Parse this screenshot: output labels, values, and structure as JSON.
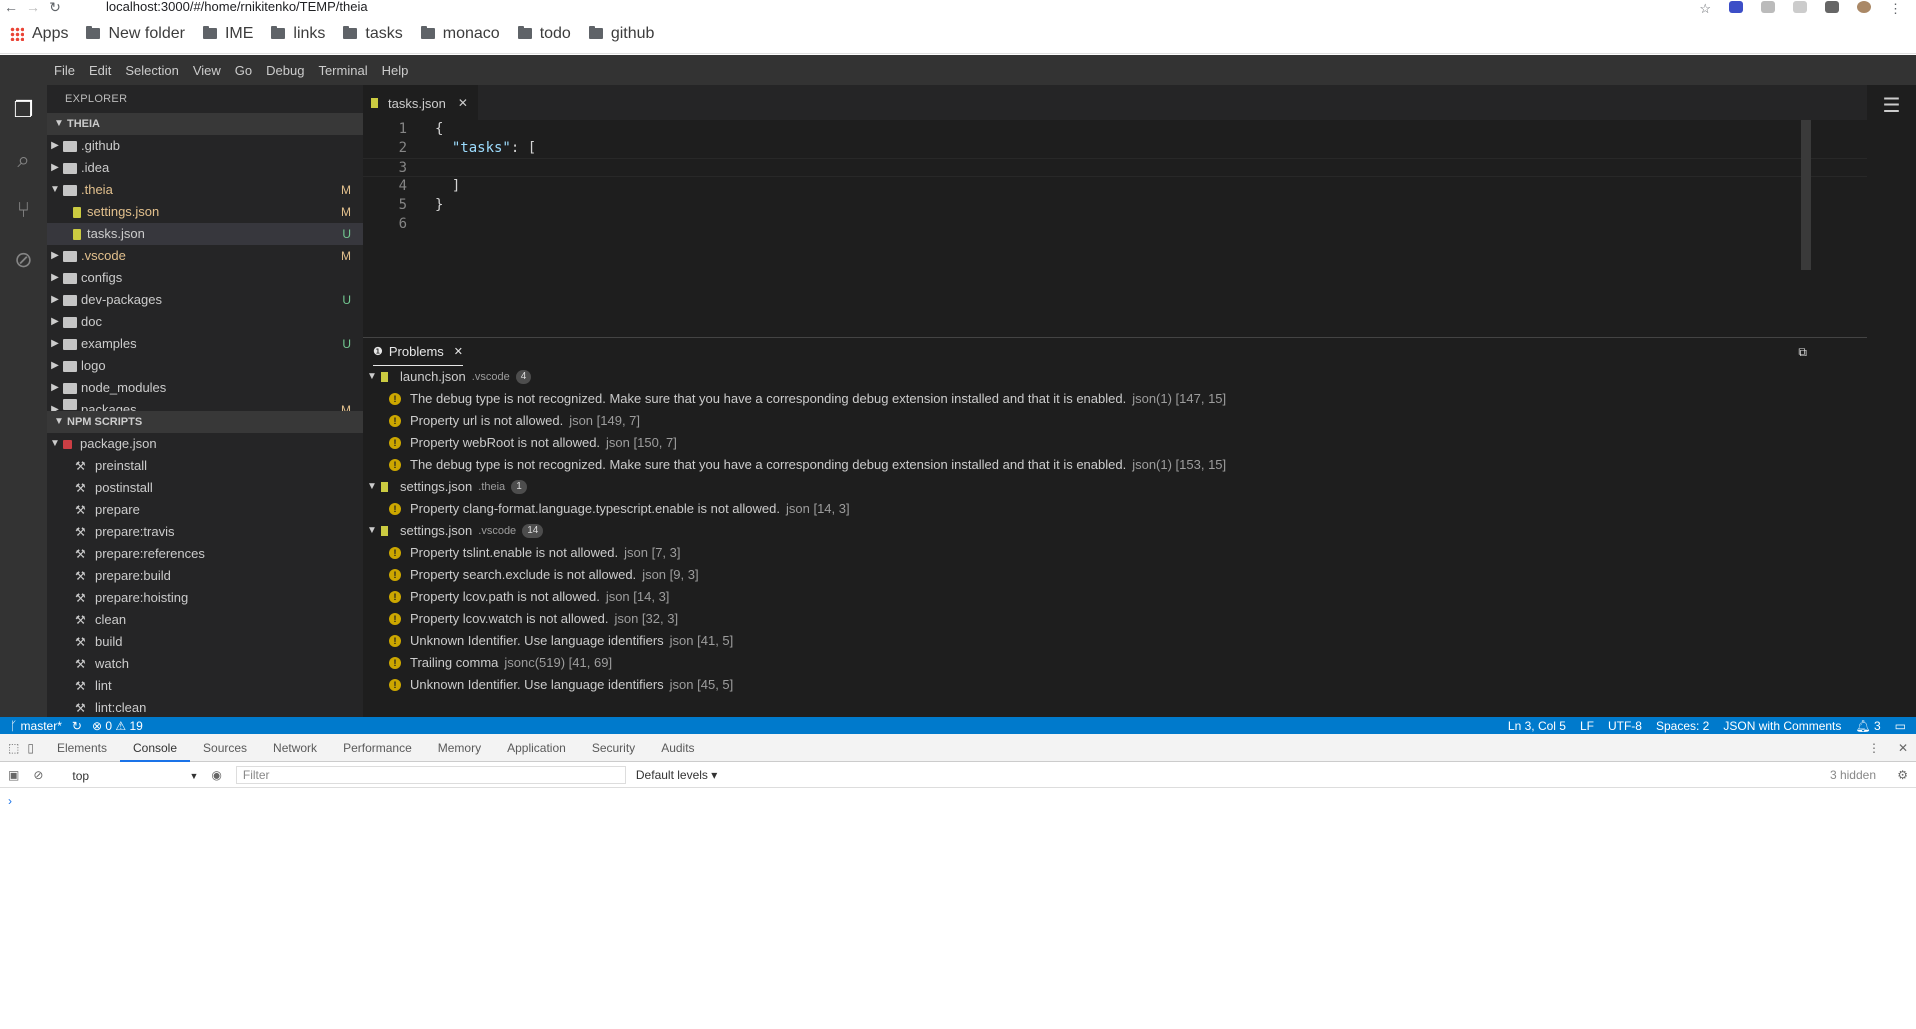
{
  "browser": {
    "url": "localhost:3000/#/home/rnikitenko/TEMP/theia",
    "bookmarks": [
      "Apps",
      "New folder",
      "IME",
      "links",
      "tasks",
      "monaco",
      "todo",
      "github"
    ]
  },
  "menu": [
    "File",
    "Edit",
    "Selection",
    "View",
    "Go",
    "Debug",
    "Terminal",
    "Help"
  ],
  "explorer": {
    "title": "EXPLORER",
    "root": "THEIA",
    "items": [
      {
        "label": ".github",
        "type": "folder",
        "badge": ""
      },
      {
        "label": ".idea",
        "type": "folder",
        "badge": ""
      },
      {
        "label": ".theia",
        "type": "folder-open",
        "badge": "M"
      },
      {
        "label": "settings.json",
        "type": "json",
        "badge": "M"
      },
      {
        "label": "tasks.json",
        "type": "json",
        "badge": "U"
      },
      {
        "label": ".vscode",
        "type": "folder",
        "badge": "M"
      },
      {
        "label": "configs",
        "type": "folder",
        "badge": ""
      },
      {
        "label": "dev-packages",
        "type": "folder",
        "badge": "U"
      },
      {
        "label": "doc",
        "type": "folder",
        "badge": ""
      },
      {
        "label": "examples",
        "type": "folder",
        "badge": "U"
      },
      {
        "label": "logo",
        "type": "folder",
        "badge": ""
      },
      {
        "label": "node_modules",
        "type": "folder",
        "badge": ""
      },
      {
        "label": "packages",
        "type": "folder",
        "badge": "M"
      }
    ]
  },
  "npm": {
    "title": "NPM SCRIPTS",
    "package": "package.json",
    "scripts": [
      "preinstall",
      "postinstall",
      "prepare",
      "prepare:travis",
      "prepare:references",
      "prepare:build",
      "prepare:hoisting",
      "clean",
      "build",
      "watch",
      "lint",
      "lint:clean"
    ]
  },
  "editor": {
    "tab": "tasks.json",
    "lines": [
      "1",
      "2",
      "3",
      "4",
      "5",
      "6"
    ],
    "code": {
      "l1": "{",
      "l2_key": "\"tasks\"",
      "l2_rest": ": [",
      "l3": "",
      "l4": "  ]",
      "l5": "}",
      "l6": ""
    }
  },
  "problems": {
    "title": "Problems",
    "groups": [
      {
        "file": "launch.json",
        "dir": ".vscode",
        "count": "4",
        "items": [
          {
            "msg": "The debug type is not recognized. Make sure that you have a corresponding debug extension installed and that it is enabled.",
            "src": "json(1) [147, 15]"
          },
          {
            "msg": "Property url is not allowed.",
            "src": "json [149, 7]"
          },
          {
            "msg": "Property webRoot is not allowed.",
            "src": "json [150, 7]"
          },
          {
            "msg": "The debug type is not recognized. Make sure that you have a corresponding debug extension installed and that it is enabled.",
            "src": "json(1) [153, 15]"
          }
        ]
      },
      {
        "file": "settings.json",
        "dir": ".theia",
        "count": "1",
        "items": [
          {
            "msg": "Property clang-format.language.typescript.enable is not allowed.",
            "src": "json [14, 3]"
          }
        ]
      },
      {
        "file": "settings.json",
        "dir": ".vscode",
        "count": "14",
        "items": [
          {
            "msg": "Property tslint.enable is not allowed.",
            "src": "json [7, 3]"
          },
          {
            "msg": "Property search.exclude is not allowed.",
            "src": "json [9, 3]"
          },
          {
            "msg": "Property lcov.path is not allowed.",
            "src": "json [14, 3]"
          },
          {
            "msg": "Property lcov.watch is not allowed.",
            "src": "json [32, 3]"
          },
          {
            "msg": "Unknown Identifier. Use language identifiers",
            "src": "json [41, 5]"
          },
          {
            "msg": "Trailing comma",
            "src": "jsonc(519) [41, 69]"
          },
          {
            "msg": "Unknown Identifier. Use language identifiers",
            "src": "json [45, 5]"
          }
        ]
      }
    ]
  },
  "status": {
    "branch": "master*",
    "errors": "0",
    "warnings": "19",
    "position": "Ln 3, Col 5",
    "eol": "LF",
    "encoding": "UTF-8",
    "spaces": "Spaces: 2",
    "language": "JSON with Comments",
    "notifications": "3"
  },
  "devtools": {
    "tabs": [
      "Elements",
      "Console",
      "Sources",
      "Network",
      "Performance",
      "Memory",
      "Application",
      "Security",
      "Audits"
    ],
    "context": "top",
    "filter_placeholder": "Filter",
    "levels": "Default levels ▾",
    "hidden": "3 hidden"
  }
}
